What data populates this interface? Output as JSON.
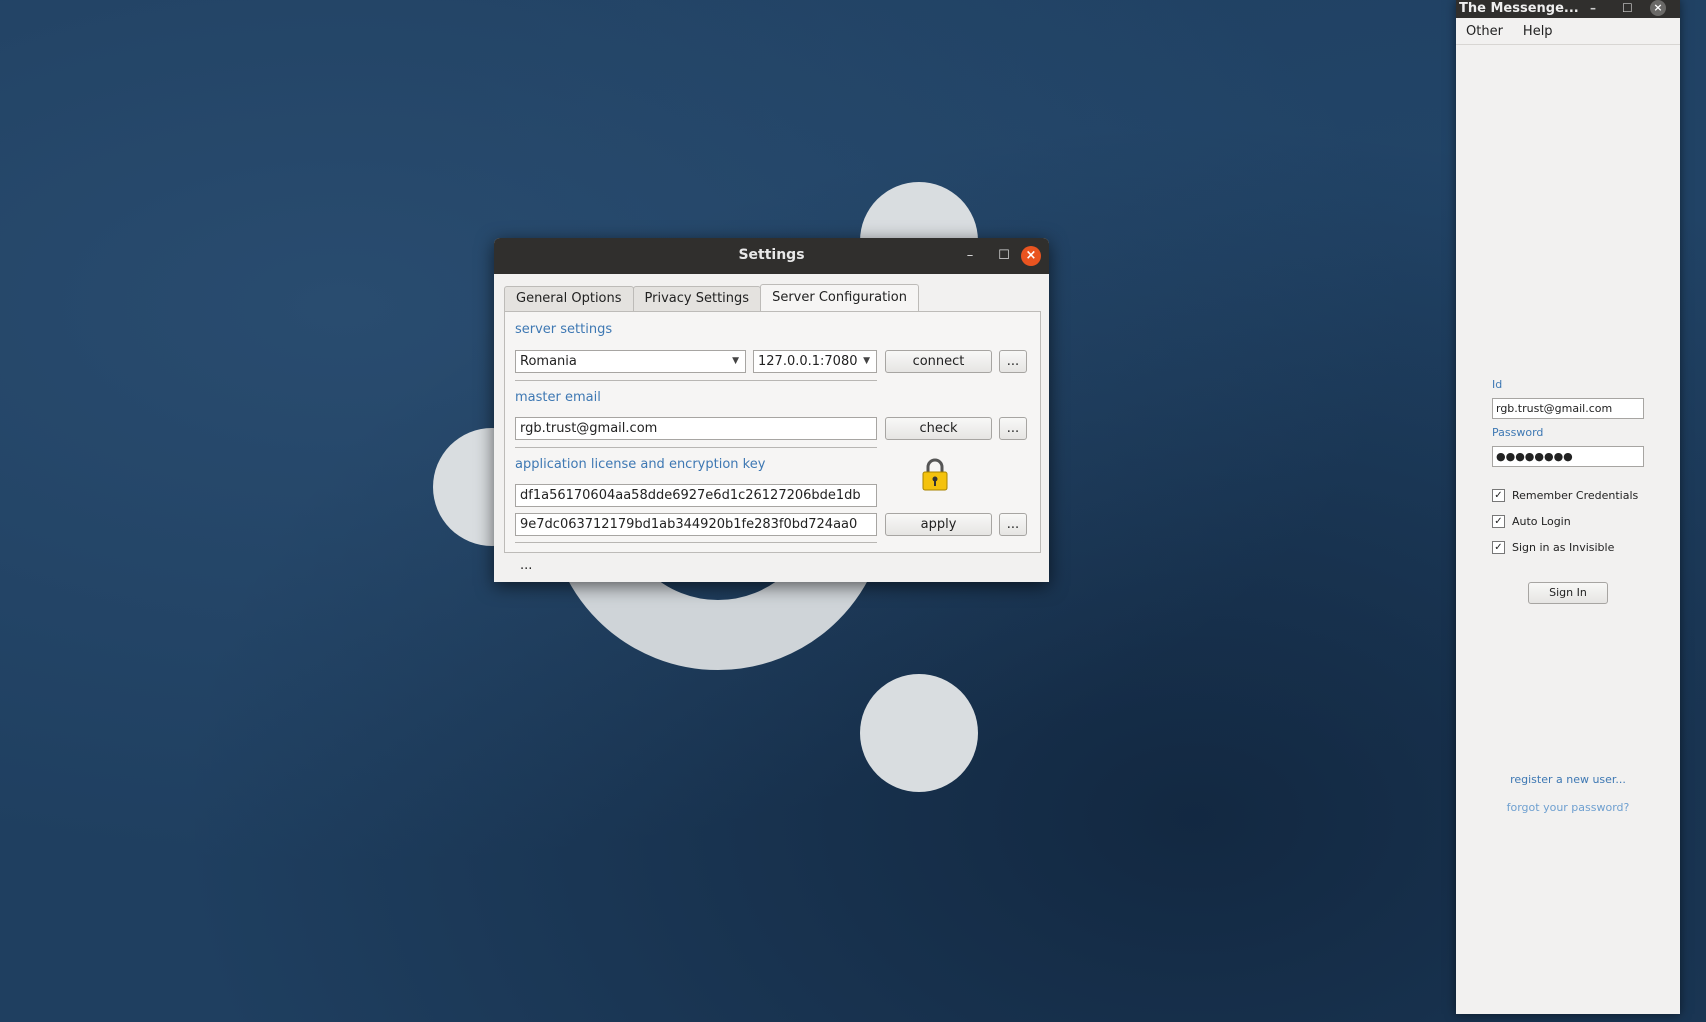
{
  "settings": {
    "title": "Settings",
    "tabs": [
      "General Options",
      "Privacy Settings",
      "Server Configuration"
    ],
    "server_settings_label": "server settings",
    "country": "Romania",
    "server": "127.0.0.1:7080",
    "connect_label": "connect",
    "more_label": "...",
    "master_email_label": "master email",
    "master_email": "rgb.trust@gmail.com",
    "check_label": "check",
    "license_label": "application license and encryption key",
    "license_key": "df1a56170604aa58dde6927e6d1c26127206bde1db",
    "encryption_key": "9e7dc063712179bd1ab344920b1fe283f0bd724aa0",
    "apply_label": "apply",
    "footer": "..."
  },
  "messenger": {
    "title": "The Messenge...",
    "menu": [
      "Other",
      "Help"
    ],
    "id_label": "Id",
    "id_value": "rgb.trust@gmail.com",
    "password_label": "Password",
    "password_value": "●●●●●●●●",
    "checks": [
      {
        "label": "Remember Credentials",
        "checked": true
      },
      {
        "label": "Auto Login",
        "checked": true
      },
      {
        "label": "Sign in as Invisible",
        "checked": true
      }
    ],
    "sign_in_label": "Sign In",
    "register_label": "register a new user...",
    "forgot_label": "forgot your password?"
  }
}
